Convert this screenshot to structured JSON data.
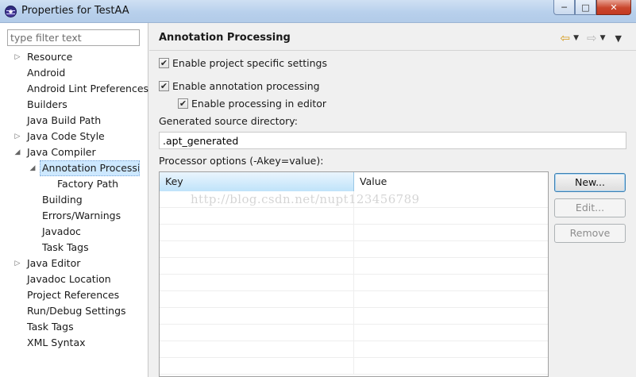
{
  "window": {
    "title": "Properties for TestAA",
    "minimize_glyph": "─",
    "maximize_glyph": "□",
    "close_glyph": "✕"
  },
  "filter": {
    "placeholder": "type filter text",
    "value": ""
  },
  "tree": [
    {
      "label": "Resource",
      "level": 0,
      "arrow": "▷"
    },
    {
      "label": "Android",
      "level": 0,
      "arrow": ""
    },
    {
      "label": "Android Lint Preferences",
      "level": 0,
      "arrow": ""
    },
    {
      "label": "Builders",
      "level": 0,
      "arrow": ""
    },
    {
      "label": "Java Build Path",
      "level": 0,
      "arrow": ""
    },
    {
      "label": "Java Code Style",
      "level": 0,
      "arrow": "▷"
    },
    {
      "label": "Java Compiler",
      "level": 0,
      "arrow": "◢"
    },
    {
      "label": "Annotation Processing",
      "level": 1,
      "arrow": "◢",
      "selected": true
    },
    {
      "label": "Factory Path",
      "level": 2,
      "arrow": ""
    },
    {
      "label": "Building",
      "level": 1,
      "arrow": ""
    },
    {
      "label": "Errors/Warnings",
      "level": 1,
      "arrow": ""
    },
    {
      "label": "Javadoc",
      "level": 1,
      "arrow": ""
    },
    {
      "label": "Task Tags",
      "level": 1,
      "arrow": ""
    },
    {
      "label": "Java Editor",
      "level": 0,
      "arrow": "▷"
    },
    {
      "label": "Javadoc Location",
      "level": 0,
      "arrow": ""
    },
    {
      "label": "Project References",
      "level": 0,
      "arrow": ""
    },
    {
      "label": "Run/Debug Settings",
      "level": 0,
      "arrow": ""
    },
    {
      "label": "Task Tags",
      "level": 0,
      "arrow": ""
    },
    {
      "label": "XML Syntax",
      "level": 0,
      "arrow": ""
    }
  ],
  "page": {
    "title": "Annotation Processing",
    "nav": {
      "back_icon": "⇦",
      "forward_icon": "⇨",
      "dropdown_icon": "▼",
      "menu_icon": "▼"
    },
    "enable_project_specific": {
      "label": "Enable project specific settings",
      "checked": true
    },
    "enable_annotation_processing": {
      "label": "Enable annotation processing",
      "checked": true
    },
    "enable_processing_in_editor": {
      "label": "Enable processing in editor",
      "checked": true
    },
    "generated_dir_label": "Generated source directory:",
    "generated_dir_value": ".apt_generated",
    "processor_options_label": "Processor options (-Akey=value):",
    "table": {
      "columns": [
        "Key",
        "Value"
      ],
      "rows": []
    },
    "watermark": "http://blog.csdn.net/nupt123456789",
    "buttons": {
      "new": "New...",
      "edit": "Edit...",
      "remove": "Remove"
    }
  },
  "colors": {
    "selection": "#cde8ff",
    "titlebar": "#b8d0ec",
    "close_button": "#c9462c"
  }
}
